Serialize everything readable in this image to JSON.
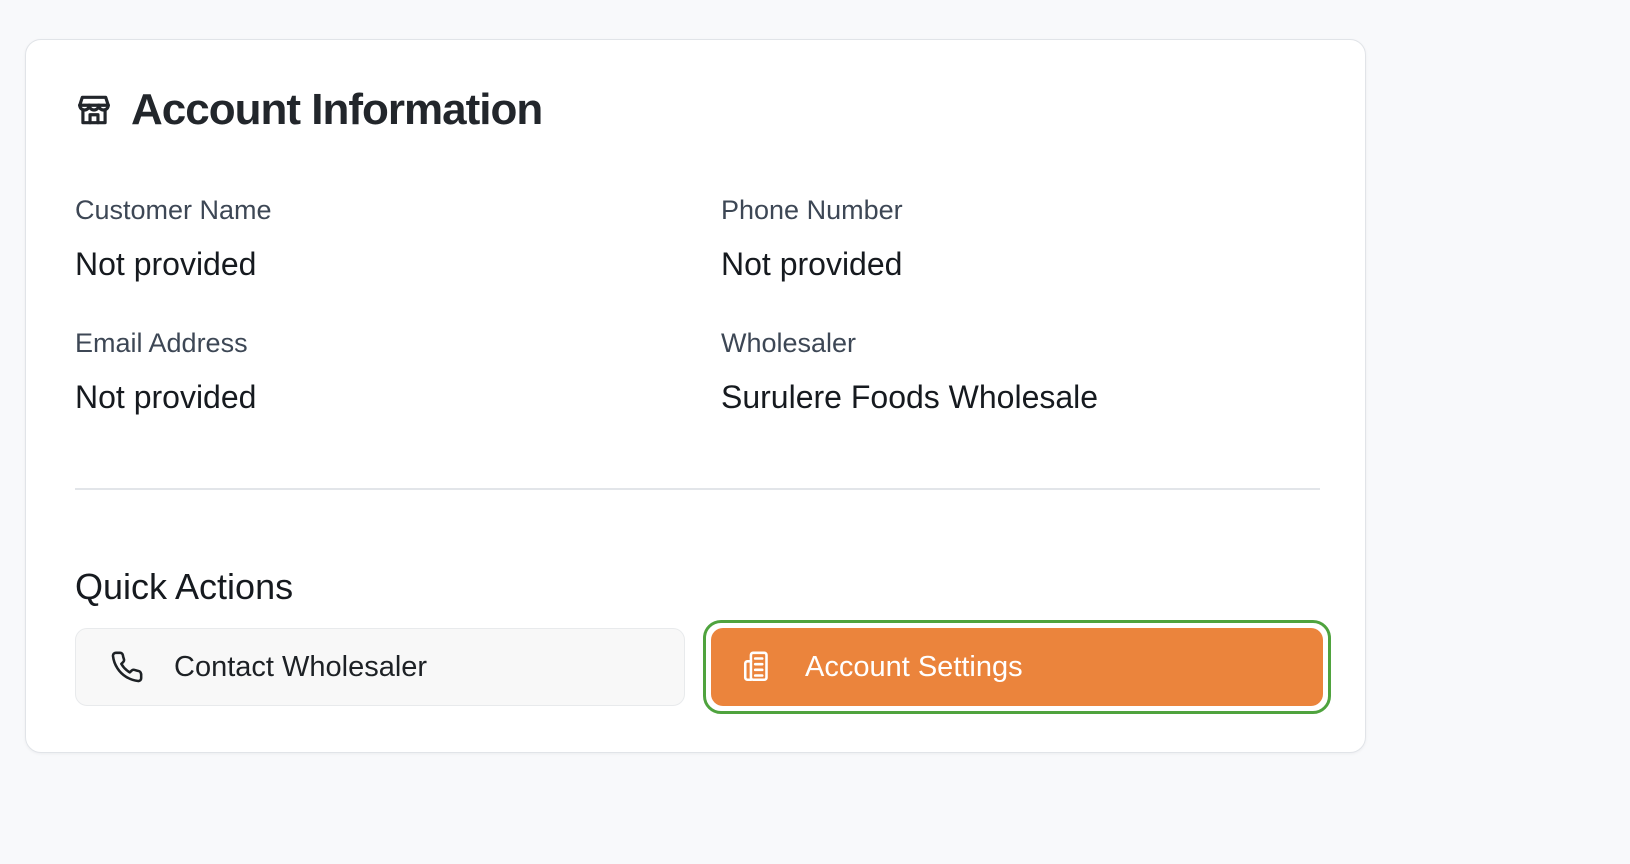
{
  "card": {
    "title": "Account Information",
    "title_icon": "storefront-icon"
  },
  "fields": [
    {
      "label": "Customer Name",
      "value": "Not provided"
    },
    {
      "label": "Phone Number",
      "value": "Not provided"
    },
    {
      "label": "Email Address",
      "value": "Not provided"
    },
    {
      "label": "Wholesaler",
      "value": "Surulere Foods Wholesale"
    }
  ],
  "quick_actions": {
    "title": "Quick Actions",
    "contact_button": {
      "label": "Contact Wholesaler",
      "icon": "phone-icon"
    },
    "settings_button": {
      "label": "Account Settings",
      "icon": "receipt-icon"
    }
  },
  "colors": {
    "accent": "#eb843c",
    "focus_ring": "#4fa33e",
    "background": "#f8f9fb",
    "card": "#ffffff"
  }
}
